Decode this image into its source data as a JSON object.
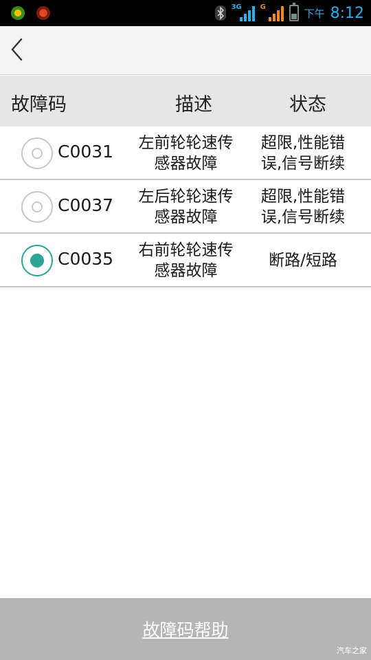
{
  "status_bar": {
    "signal_1_tag": "3G",
    "signal_2_tag": "G",
    "time_label": "下午",
    "time_value": "8:12",
    "signal_color": "#2ab0e8",
    "signal_alt_color": "#f28a1a"
  },
  "header": {
    "code": "故障码",
    "description": "描述",
    "status": "状态"
  },
  "rows": [
    {
      "code": "C0031",
      "desc_line1": "左前轮轮速传",
      "desc_line2": "感器故障",
      "state_line1": "超限,性能错",
      "state_line2": "误,信号断续",
      "selected": false
    },
    {
      "code": "C0037",
      "desc_line1": "左后轮轮速传",
      "desc_line2": "感器故障",
      "state_line1": "超限,性能错",
      "state_line2": "误,信号断续",
      "selected": false
    },
    {
      "code": "C0035",
      "desc_line1": "右前轮轮速传",
      "desc_line2": "感器故障",
      "state_line1": "断路/短路",
      "state_line2": "",
      "selected": true
    }
  ],
  "help_button": {
    "label": "故障码帮助"
  },
  "watermark": "汽车之家",
  "colors": {
    "accent": "#2aa596",
    "help_bar": "#b5b5b5"
  }
}
